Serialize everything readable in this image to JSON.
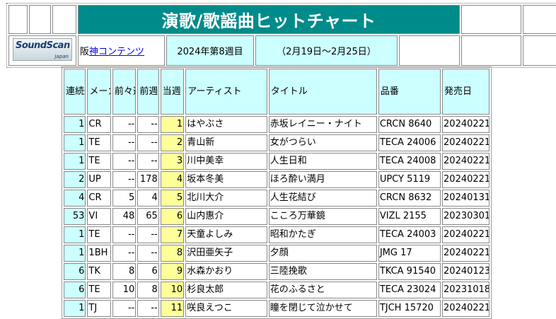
{
  "header": {
    "title": "演歌/歌謡曲ヒットチャート",
    "logo_text": "SoundScan",
    "logo_sub": "Japan",
    "link_prefix": "阪",
    "link_text": "神コンテンツ",
    "week": "2024年第8週目",
    "period": "（2月19日～2月25日）"
  },
  "chart": {
    "columns": {
      "streak": "連続登場回数",
      "maker": "メーカー",
      "prev2": "前々週",
      "prev": "前週",
      "rank": "当週",
      "artist": "アーティスト",
      "title": "タイトル",
      "catalog": "品番",
      "release": "発売日"
    },
    "rows": [
      {
        "streak": "1",
        "maker": "CR",
        "prev2": "--",
        "prev": "--",
        "rank": "1",
        "artist": "はやぶさ",
        "title": "赤坂レイニー・ナイト",
        "catalog": "CRCN 8640",
        "release": "20240221"
      },
      {
        "streak": "1",
        "maker": "TE",
        "prev2": "--",
        "prev": "--",
        "rank": "2",
        "artist": "青山新",
        "title": "女がつらい",
        "catalog": "TECA 24006",
        "release": "20240221"
      },
      {
        "streak": "1",
        "maker": "TE",
        "prev2": "--",
        "prev": "--",
        "rank": "3",
        "artist": "川中美幸",
        "title": "人生日和",
        "catalog": "TECA 24008",
        "release": "20240221"
      },
      {
        "streak": "2",
        "maker": "UP",
        "prev2": "--",
        "prev": "178",
        "rank": "4",
        "artist": "坂本冬美",
        "title": "ほろ酔い満月",
        "catalog": "UPCY 5119",
        "release": "20240221"
      },
      {
        "streak": "4",
        "maker": "CR",
        "prev2": "5",
        "prev": "4",
        "rank": "5",
        "artist": "北川大介",
        "title": "人生花結び",
        "catalog": "CRCN 8632",
        "release": "20240131"
      },
      {
        "streak": "53",
        "maker": "VI",
        "prev2": "48",
        "prev": "65",
        "rank": "6",
        "artist": "山内惠介",
        "title": "こころ万華鏡",
        "catalog": "VIZL 2155",
        "release": "20230301"
      },
      {
        "streak": "1",
        "maker": "TE",
        "prev2": "--",
        "prev": "--",
        "rank": "7",
        "artist": "天童よしみ",
        "title": "昭和かたぎ",
        "catalog": "TECA 24003",
        "release": "20240221"
      },
      {
        "streak": "1",
        "maker": "1BH",
        "prev2": "--",
        "prev": "--",
        "rank": "8",
        "artist": "沢田亜矢子",
        "title": "夕顔",
        "catalog": "JMG 17",
        "release": "20240221"
      },
      {
        "streak": "6",
        "maker": "TK",
        "prev2": "8",
        "prev": "6",
        "rank": "9",
        "artist": "水森かおり",
        "title": "三陸挽歌",
        "catalog": "TKCA 91540",
        "release": "20240123"
      },
      {
        "streak": "6",
        "maker": "TE",
        "prev2": "10",
        "prev": "8",
        "rank": "10",
        "artist": "杉良太郎",
        "title": "花のふるさと",
        "catalog": "TECA 23024",
        "release": "20231018"
      },
      {
        "streak": "1",
        "maker": "TJ",
        "prev2": "--",
        "prev": "--",
        "rank": "11",
        "artist": "咲良えつこ",
        "title": "瞳を閉じて泣かせて",
        "catalog": "TJCH 15720",
        "release": "20240221"
      }
    ]
  }
}
